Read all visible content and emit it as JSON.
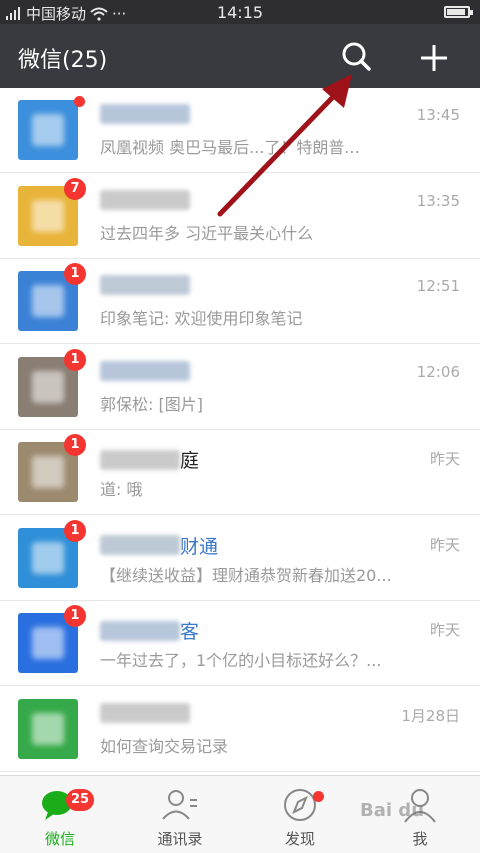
{
  "status_bar": {
    "carrier": "中国移动",
    "more": "···",
    "time": "14:15",
    "battery_level": 0.9
  },
  "header": {
    "title": "微信(25)",
    "search_icon": "search-icon",
    "add_icon": "plus-icon"
  },
  "chats": [
    {
      "name_visible": "",
      "time": "13:45",
      "preview": "凤凰视频 奥巴马最后...了！特朗普...",
      "badge": "",
      "has_dot": true,
      "avatar_color": "#3b8fdc"
    },
    {
      "name_visible": "",
      "time": "13:35",
      "preview": "过去四年多 习近平最关心什么",
      "badge": "7",
      "has_dot": false,
      "avatar_color": "#e8b43a"
    },
    {
      "name_visible": "",
      "time": "12:51",
      "preview": "印象笔记: 欢迎使用印象笔记",
      "badge": "1",
      "has_dot": false,
      "avatar_color": "#3b82d6"
    },
    {
      "name_visible": "",
      "time": "12:06",
      "preview": "郭保松: [图片]",
      "badge": "1",
      "has_dot": false,
      "avatar_color": "#8a7d72"
    },
    {
      "name_visible": "庭",
      "time": "昨天",
      "preview": "道: 哦",
      "badge": "1",
      "has_dot": false,
      "avatar_color": "#9c8a6f"
    },
    {
      "name_visible": "财通",
      "time": "昨天",
      "preview": "【继续送收益】理财通恭贺新春加送20...",
      "badge": "1",
      "has_dot": false,
      "avatar_color": "#2f8fd8"
    },
    {
      "name_visible": "客",
      "time": "昨天",
      "preview": "一年过去了，1个亿的小目标还好么？...",
      "badge": "1",
      "has_dot": false,
      "avatar_color": "#2a6fe0"
    },
    {
      "name_visible": "",
      "time": "1月28日",
      "preview": "如何查询交易记录",
      "badge": "",
      "has_dot": false,
      "avatar_color": "#36a94a"
    }
  ],
  "tabs": [
    {
      "label": "微信",
      "icon": "chat-bubble-icon",
      "badge": "25",
      "active": true
    },
    {
      "label": "通讯录",
      "icon": "contacts-icon",
      "badge": "",
      "active": false
    },
    {
      "label": "发现",
      "icon": "compass-icon",
      "badge": "",
      "dot": true,
      "active": false
    },
    {
      "label": "我",
      "icon": "person-icon",
      "badge": "",
      "active": false
    }
  ],
  "colors": {
    "header_bg": "#393a3f",
    "status_bg": "#2e2e32",
    "badge_red": "#f43530",
    "wechat_green": "#1aad19",
    "arrow_red": "#a0121a"
  },
  "watermark": "Bai du"
}
